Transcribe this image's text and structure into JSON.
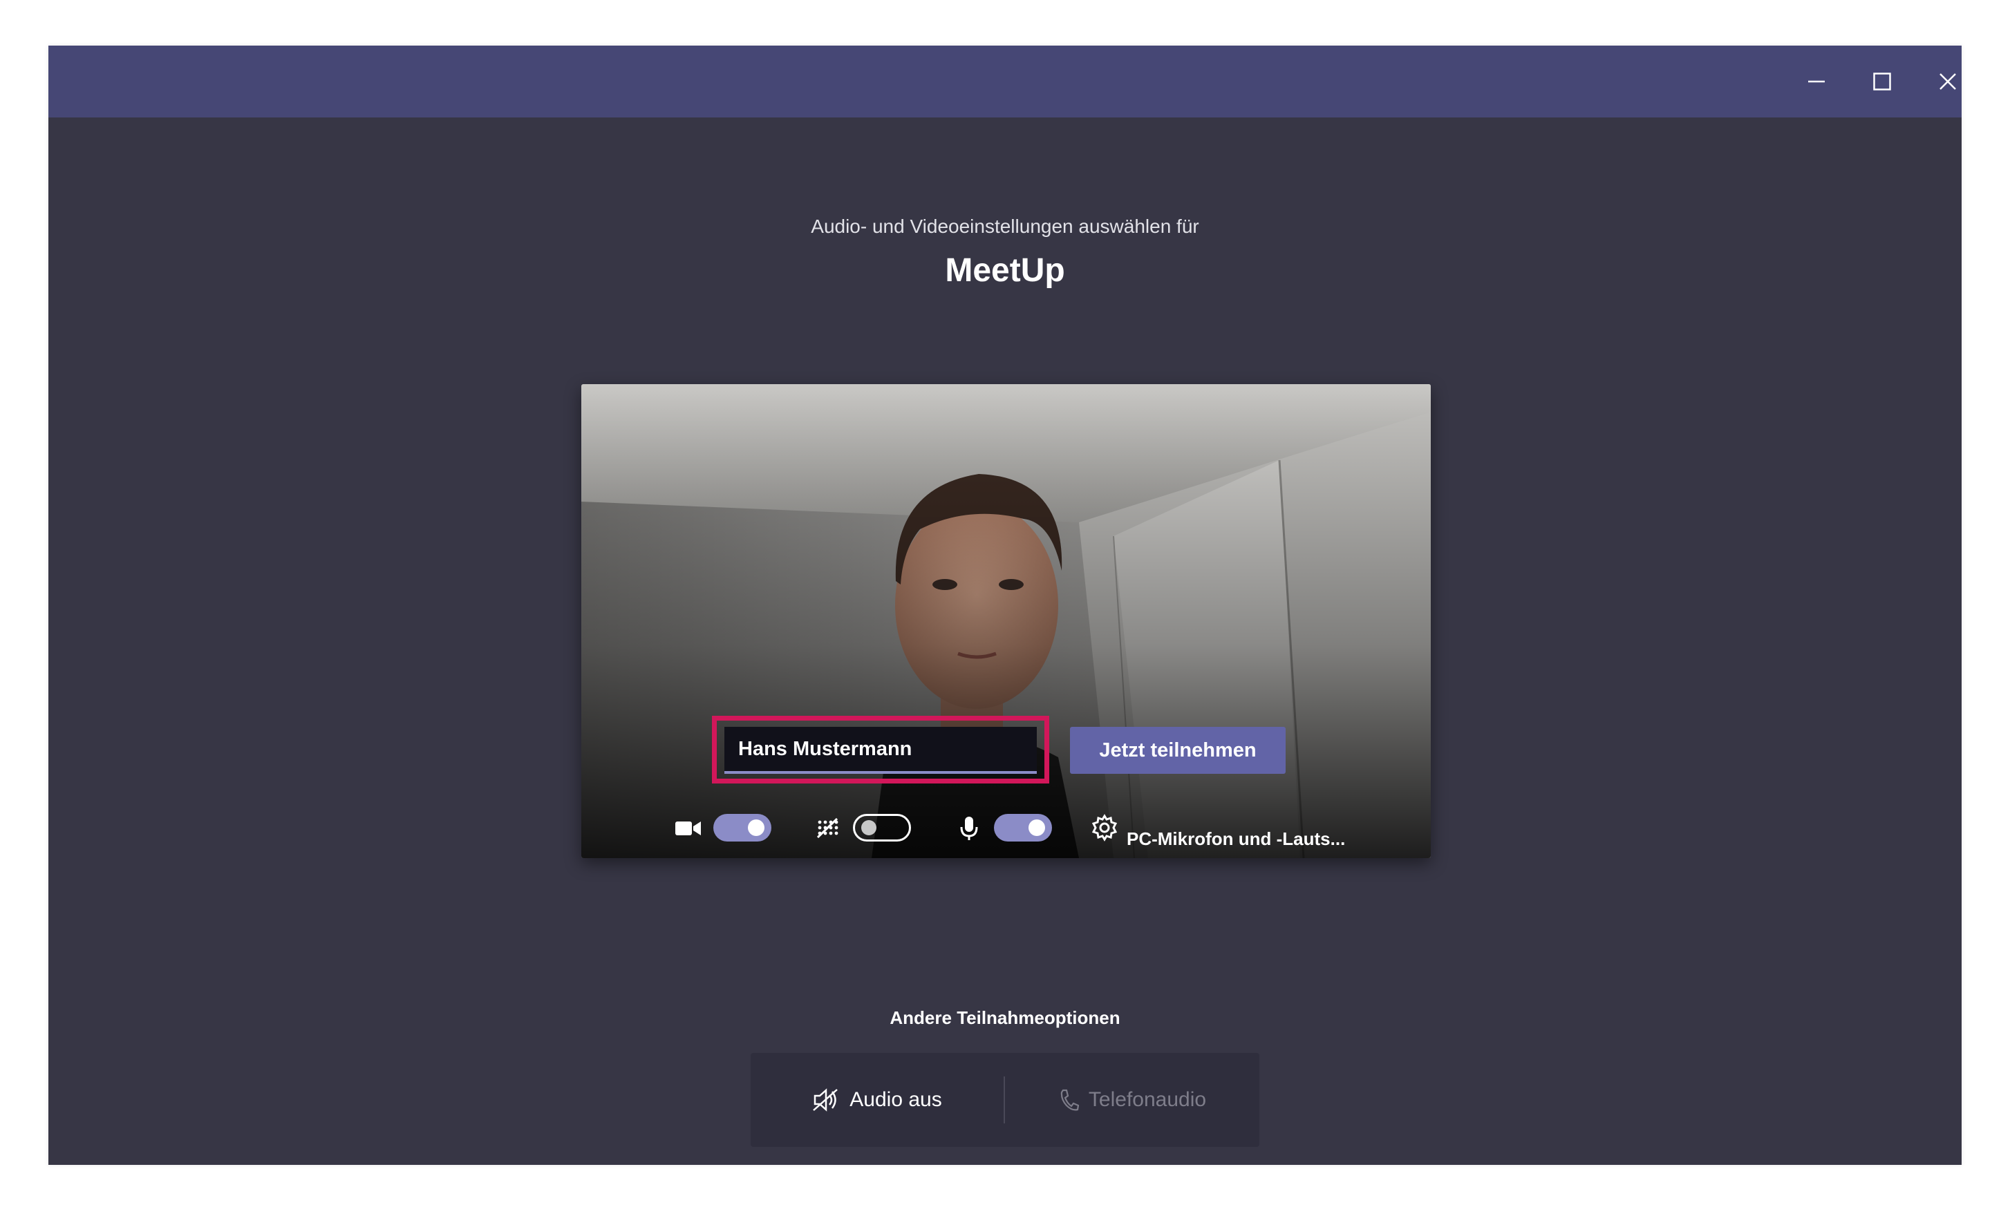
{
  "window": {
    "controls": {
      "minimize_icon": "minimize-icon",
      "maximize_icon": "maximize-icon",
      "close_icon": "close-icon"
    }
  },
  "header": {
    "subtitle": "Audio- und Videoeinstellungen auswählen für",
    "meeting_name": "MeetUp"
  },
  "preview": {
    "name_input_value": "Hans Mustermann",
    "join_label": "Jetzt teilnehmen",
    "highlight_color": "#d2175a"
  },
  "controls": {
    "camera": {
      "icon": "camera-icon",
      "on": true
    },
    "background_blur": {
      "icon": "blur-icon",
      "on": false
    },
    "microphone": {
      "icon": "microphone-icon",
      "on": true
    },
    "device_settings": {
      "icon": "gear-icon",
      "label": "PC-Mikrofon und -Lauts..."
    }
  },
  "other_options": {
    "title": "Andere Teilnahmeoptionen",
    "audio_off": {
      "icon": "speaker-off-icon",
      "label": "Audio aus"
    },
    "phone_audio": {
      "icon": "phone-icon",
      "label": "Telefonaudio"
    }
  },
  "colors": {
    "titlebar": "#464775",
    "background": "#373645",
    "accent": "#6264a7",
    "toggle_on": "#8b8cc7"
  }
}
